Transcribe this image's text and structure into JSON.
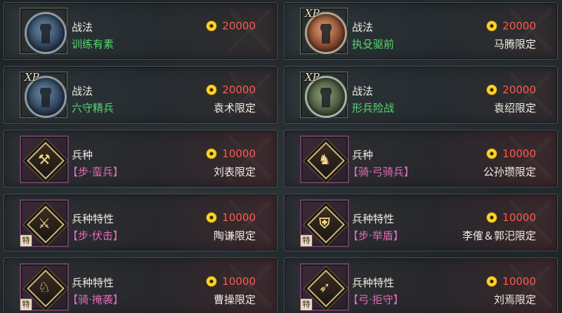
{
  "cards": [
    {
      "category": "战法",
      "name": "训练有素",
      "cost": "20000",
      "limit": "",
      "type": "tactic",
      "xp": false,
      "icon": "general-portrait-icon",
      "medal": "blue"
    },
    {
      "category": "战法",
      "name": "执殳驱前",
      "cost": "20000",
      "limit": "马腾限定",
      "type": "tactic",
      "xp": true,
      "xp_label": "XP",
      "icon": "general-portrait-icon",
      "medal": "fire"
    },
    {
      "category": "战法",
      "name": "六守精兵",
      "cost": "20000",
      "limit": "袁术限定",
      "type": "tactic",
      "xp": true,
      "xp_label": "XP",
      "icon": "general-portrait-icon",
      "medal": "blue"
    },
    {
      "category": "战法",
      "name": "形兵险战",
      "cost": "20000",
      "limit": "袁绍限定",
      "type": "tactic",
      "xp": true,
      "xp_label": "XP",
      "icon": "general-portrait-icon",
      "medal": "green"
    },
    {
      "category": "兵种",
      "name": "【步·蛮兵】",
      "cost": "10000",
      "limit": "刘表限定",
      "type": "troop",
      "glyph": "⚒",
      "icon": "axe-troop-icon"
    },
    {
      "category": "兵种",
      "name": "【骑·弓骑兵】",
      "cost": "10000",
      "limit": "公孙瓒限定",
      "type": "troop",
      "glyph": "♞",
      "icon": "horse-archer-troop-icon"
    },
    {
      "category": "兵种特性",
      "name": "【步·伏击】",
      "cost": "10000",
      "limit": "陶谦限定",
      "type": "troop",
      "glyph": "⚔",
      "tag": "特",
      "icon": "ambush-trait-icon"
    },
    {
      "category": "兵种特性",
      "name": "【步·举盾】",
      "cost": "10000",
      "limit": "李傕＆郭汜限定",
      "type": "troop",
      "glyph": "⛨",
      "tag": "特",
      "icon": "shield-trait-icon"
    },
    {
      "category": "兵种特性",
      "name": "【骑·掩袭】",
      "cost": "10000",
      "limit": "曹操限定",
      "type": "troop",
      "glyph": "♘",
      "tag": "特",
      "icon": "cavalry-raid-trait-icon"
    },
    {
      "category": "兵种特性",
      "name": "【弓·拒守】",
      "cost": "10000",
      "limit": "刘焉限定",
      "type": "troop",
      "glyph": "➶",
      "tag": "特",
      "icon": "bow-defense-trait-icon"
    }
  ],
  "colors": {
    "name_tactic": "#57d86f",
    "name_troop": "#e46ab8",
    "cost": "#ff5a4a",
    "coin": "#ffd21e"
  }
}
